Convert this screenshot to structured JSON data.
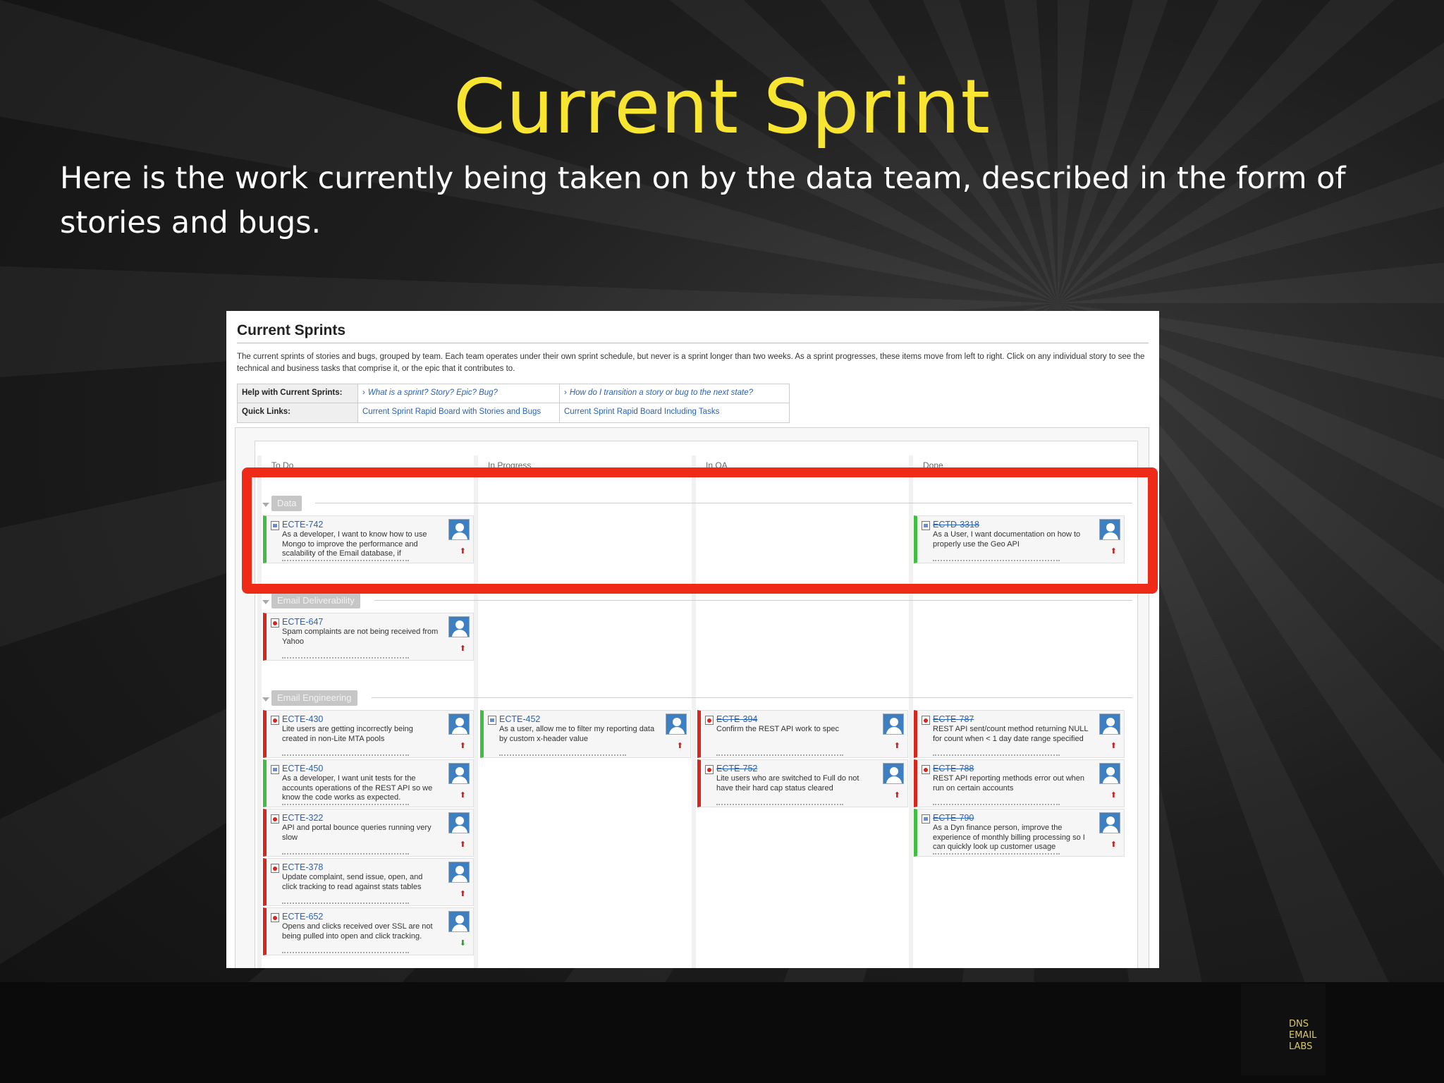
{
  "slide": {
    "title": "Current Sprint",
    "subtitle": "Here is the work currently being taken on by the data team, described in the form of stories and bugs.",
    "logo_text": "DNS\nEMAIL\nLABS"
  },
  "panel": {
    "title": "Current Sprints",
    "description": "The current sprints of stories and bugs, grouped by team. Each team operates under their own sprint schedule, but never is a sprint longer than two weeks. As a sprint progresses, these items move from left to right. Click on any individual story to see the technical and business tasks that comprise it, or the epic that it contributes to.",
    "help": {
      "help_label": "Help with Current Sprints:",
      "help_link1": "What is a sprint? Story? Epic? Bug?",
      "help_link2": "How do I transition a story or bug to the next state?",
      "quick_label": "Quick Links:",
      "quick_link1": "Current Sprint Rapid Board with Stories and Bugs",
      "quick_link2": "Current Sprint Rapid Board Including Tasks"
    },
    "column_headers": [
      "To Do",
      "In Progress",
      "In QA",
      "Done"
    ]
  },
  "swimlanes": {
    "data": "Data",
    "deliverability": "Email Deliverability",
    "engineering": "Email Engineering"
  },
  "cards": {
    "ecte742": {
      "key": "ECTE-742",
      "summary": "As a developer, I want to know how to use Mongo to improve the performance and scalability of the Email database, if"
    },
    "ectd3318": {
      "key": "ECTD-3318",
      "summary": "As a User, I want documentation on how to properly use the Geo API"
    },
    "ecte647": {
      "key": "ECTE-647",
      "summary": "Spam complaints are not being received from Yahoo"
    },
    "ecte430": {
      "key": "ECTE-430",
      "summary": "Lite users are getting incorrectly being created in non-Lite MTA pools"
    },
    "ecte450": {
      "key": "ECTE-450",
      "summary": "As a developer, I want unit tests for the accounts operations of the REST API so we know the code works as expected."
    },
    "ecte322": {
      "key": "ECTE-322",
      "summary": "API and portal bounce queries running very slow"
    },
    "ecte378": {
      "key": "ECTE-378",
      "summary": "Update complaint, send issue, open, and click tracking to read against stats tables"
    },
    "ecte652": {
      "key": "ECTE-652",
      "summary": "Opens and clicks received over SSL are not being pulled into open and click tracking."
    },
    "ecte452": {
      "key": "ECTE-452",
      "summary": "As a user, allow me to filter my reporting data by custom x-header value"
    },
    "ecte394": {
      "key": "ECTE-394",
      "summary": "Confirm the REST API work to spec"
    },
    "ecte752": {
      "key": "ECTE-752",
      "summary": "Lite users who are switched to Full do not have their hard cap status cleared"
    },
    "ecte787": {
      "key": "ECTE-787",
      "summary": "REST API sent/count method returning NULL for count when < 1 day date range specified"
    },
    "ecte788": {
      "key": "ECTE-788",
      "summary": "REST API reporting methods error out when run on certain accounts"
    },
    "ecte790": {
      "key": "ECTE-790",
      "summary": "As a Dyn finance person, improve the experience of monthly billing processing so I can quickly look up customer usage"
    }
  },
  "colors": {
    "title_yellow": "#f7e531",
    "highlight_red": "#ef2a16",
    "story_green": "#3fbf3f",
    "bug_red": "#d9261c",
    "link_blue": "#2a63b8"
  },
  "icons": [
    "story-icon",
    "bug-icon",
    "avatar-icon",
    "priority-up-icon",
    "priority-down-icon",
    "collapse-icon"
  ]
}
